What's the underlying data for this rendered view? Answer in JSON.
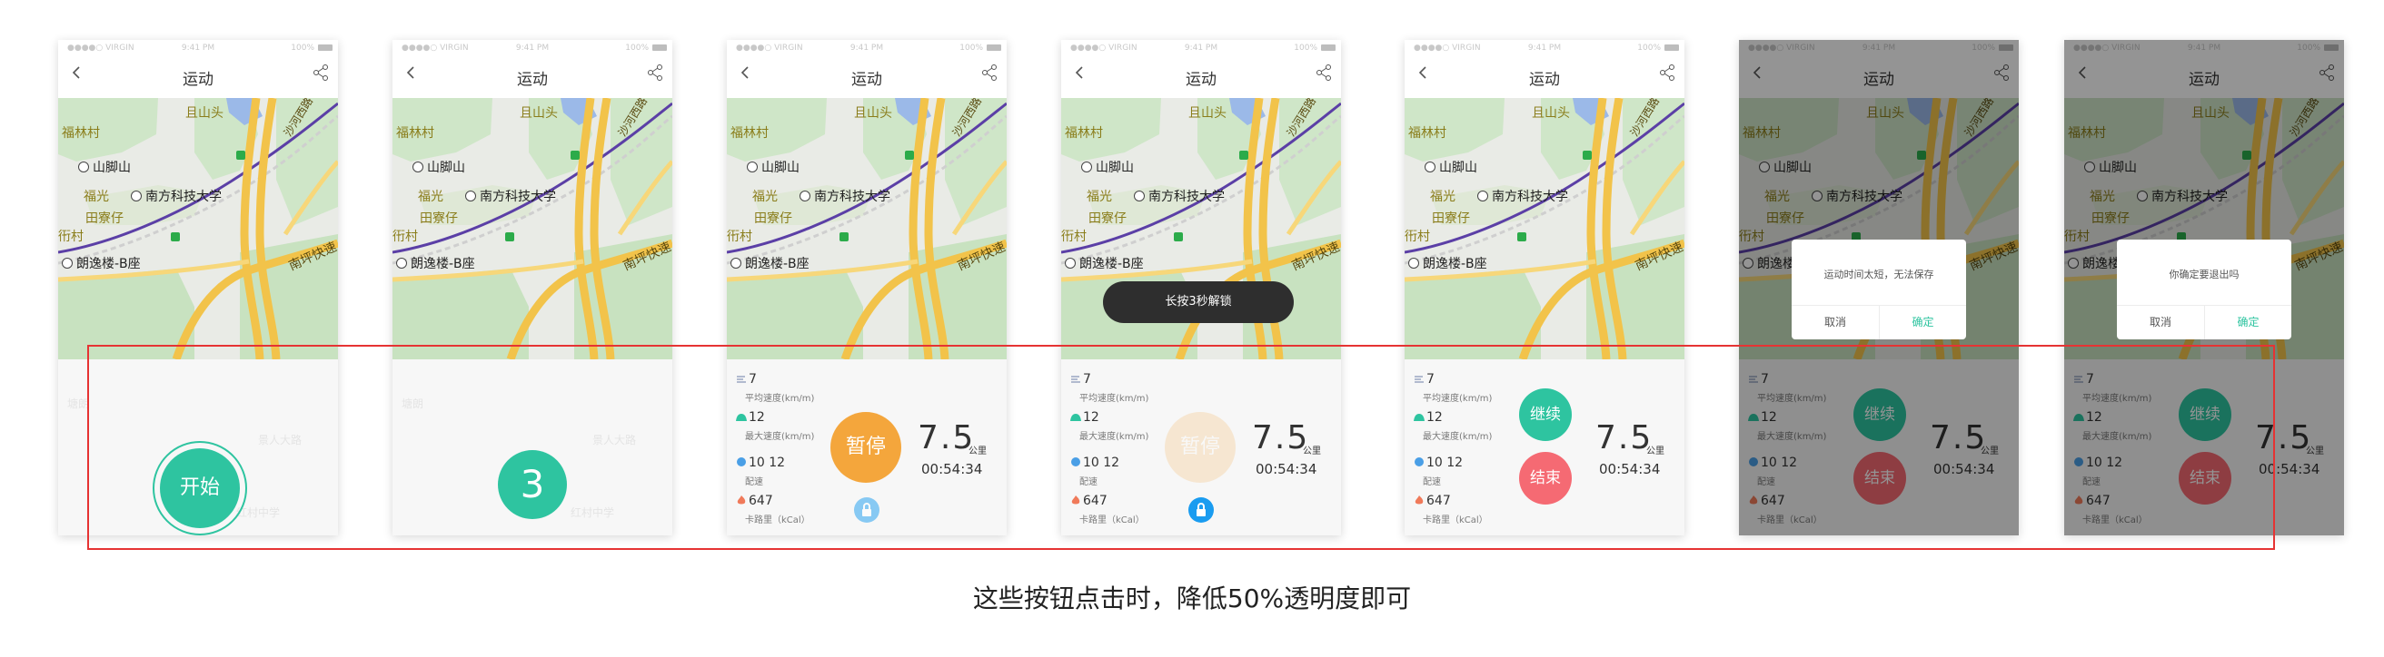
{
  "status": {
    "carrier": "●●●●○ VIRGIN",
    "time": "9:41 PM",
    "battery": "100%"
  },
  "nav": {
    "title": "运动"
  },
  "map_labels": {
    "village": "福林村",
    "mountain_top": "且山头",
    "shan_jiao": "山脚山",
    "fu_guang": "福光",
    "university": "南方科技大学",
    "tian_liao": "田寮仔",
    "cut_village": "衎村",
    "building": "朗逸楼-B座",
    "expressway": "南坪快速",
    "road_ne": "沙河西路"
  },
  "ghost_labels": {
    "a": "红村中学",
    "b": "景人大路",
    "c": "塘朗"
  },
  "screens": [
    {
      "id": "start",
      "start_label": "开始"
    },
    {
      "id": "countdown",
      "count": "3"
    },
    {
      "id": "running",
      "pause_label": "暂停",
      "pause_opacity": 1.0,
      "lock_opacity": 0.5
    },
    {
      "id": "locked",
      "pause_label": "暂停",
      "pause_opacity": 0.2,
      "lock_opacity": 1.0,
      "toast": "长按3秒解锁"
    },
    {
      "id": "paused",
      "resume_label": "继续",
      "end_label": "结束"
    },
    {
      "id": "too-short",
      "resume_label": "继续",
      "end_label": "结束",
      "dialog": {
        "message": "运动时间太短，无法保存",
        "cancel": "取消",
        "confirm": "确定"
      }
    },
    {
      "id": "confirm-exit",
      "resume_label": "继续",
      "end_label": "结束",
      "dialog": {
        "message": "你确定要退出吗",
        "cancel": "取消",
        "confirm": "确定"
      }
    }
  ],
  "stats": [
    {
      "value": "7",
      "caption": "平均速度(km/m)",
      "icon": "speed-icon",
      "color": "#9aa6c2"
    },
    {
      "value": "12",
      "caption": "最大速度(km/m)",
      "icon": "max-speed-icon",
      "color": "#2ec4a0"
    },
    {
      "value": "10 12",
      "caption": "配速",
      "icon": "pace-drop-icon",
      "color": "#4a9fe6"
    },
    {
      "value": "647",
      "caption": "卡路里（kCal）",
      "icon": "flame-icon",
      "color": "#f07a5a"
    }
  ],
  "distance": {
    "value": "7.5",
    "unit": "公里"
  },
  "timer": "00:54:34",
  "caption": "这些按钮点击时，降低50%透明度即可",
  "colors": {
    "accent": "#2ec4a0",
    "pause": "#f4a63c",
    "end": "#f56a73",
    "lock": "#1a9cf0",
    "redbox": "#e63333"
  }
}
